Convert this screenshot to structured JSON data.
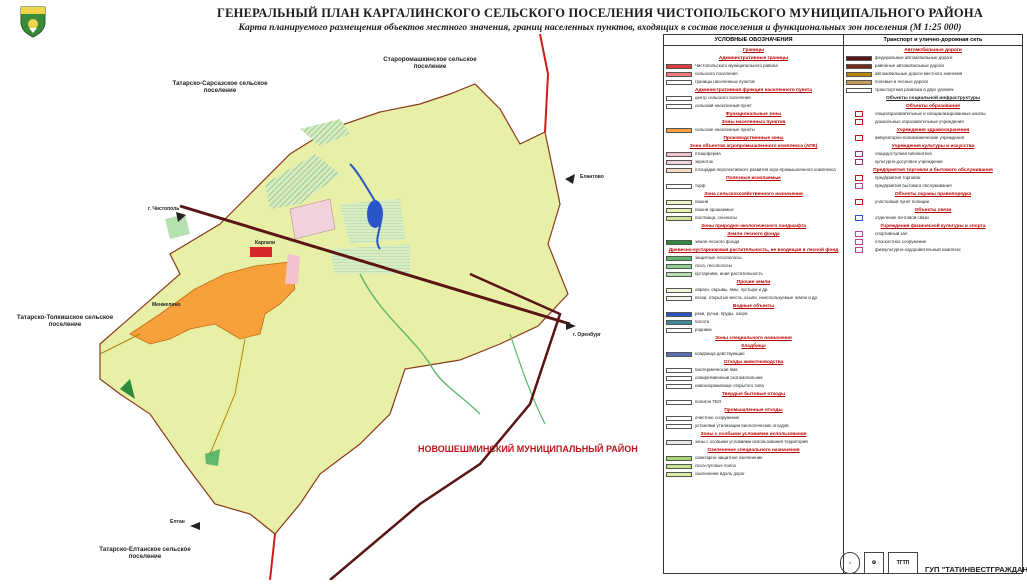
{
  "title": {
    "main": "ГЕНЕРАЛЬНЫЙ ПЛАН КАРГАЛИНСКОГО СЕЛЬСКОГО ПОСЕЛЕНИЯ ЧИСТОПОЛЬСКОГО МУНИЦИПАЛЬНОГО РАЙОНА",
    "sub": "Карта планируемого размещения объектов местного значения, границ населенных пунктов, входящих в состав поселения и функциональных зон поселения (М 1:25 000)"
  },
  "map": {
    "neighbors": [
      "Татарско-Сарсазское сельское поселение",
      "Староромашкинское сельское поселение",
      "Татарско-Толкишское сельское поселение",
      "Татарско-Елтанское сельское поселение"
    ],
    "district": "НОВОШЕШМИНСКИЙ МУНИЦИПАЛЬНЫЙ РАЙОН",
    "road_tags": [
      "г. Чистополь",
      "Елантово",
      "г. Оренбург",
      "Елтан"
    ],
    "villages": [
      "Каргали",
      "Менжелино"
    ],
    "colors": {
      "territory": "#e7f0a6",
      "settlement": "#f7a03c",
      "forest": "#c6e99b",
      "water": "#2a55c8",
      "road": "#5a1414",
      "boundary": "#d11a1a",
      "district_text": "#c0141c"
    }
  },
  "legend": {
    "left_header": "УСЛОВНЫЕ ОБОЗНАЧЕНИЯ",
    "right_header": "Транспорт и улично-дорожная сеть",
    "left": [
      {
        "kind": "sec",
        "text": "Границы"
      },
      {
        "kind": "sec",
        "text": "Административные границы"
      },
      {
        "kind": "row",
        "swatch": "#e23b3b",
        "text": "Чистопольского муниципального района"
      },
      {
        "kind": "row",
        "swatch": "#f07a7a",
        "text": "сельского поселения"
      },
      {
        "kind": "row",
        "swatch": "#ffffff",
        "text": "границы населенных пунктов"
      },
      {
        "kind": "sec",
        "text": "Административная функция населенного пункта"
      },
      {
        "kind": "row",
        "swatch": "#ffffff",
        "text": "центр сельского поселения"
      },
      {
        "kind": "row",
        "swatch": "#ffffff",
        "text": "сельский населенный пункт"
      },
      {
        "kind": "sec",
        "text": "Функциональные зоны"
      },
      {
        "kind": "sec",
        "text": "Зоны населенных пунктов"
      },
      {
        "kind": "row",
        "swatch": "#f7a03c",
        "text": "сельские населенные пункты"
      },
      {
        "kind": "sec",
        "text": "Производственные зоны"
      },
      {
        "kind": "sec",
        "text": "Зона объектов агропромышленного комплекса (АПК)"
      },
      {
        "kind": "row",
        "swatch": "#f3c2cc",
        "text": "птицеферма"
      },
      {
        "kind": "row",
        "swatch": "#f0d2da",
        "text": "зерноток"
      },
      {
        "kind": "row",
        "swatch": "#f4dcc0",
        "text": "площадки перспективного развития агро-промышленного комплекса"
      },
      {
        "kind": "sec",
        "text": "Полезные ископаемые"
      },
      {
        "kind": "row",
        "swatch": "#ffffff",
        "text": "торф"
      },
      {
        "kind": "sec",
        "text": "Зона сельскохозяйственного назначения"
      },
      {
        "kind": "row",
        "swatch": "#f1f6c6",
        "text": "пашни"
      },
      {
        "kind": "row",
        "swatch": "#e5f2b4",
        "text": "пашни орошаемые"
      },
      {
        "kind": "row",
        "swatch": "#cfe69a",
        "text": "пастбища, сенокосы"
      },
      {
        "kind": "sec",
        "text": "Зоны природно-экологического ландшафта"
      },
      {
        "kind": "sec",
        "text": "Земли лесного фонда"
      },
      {
        "kind": "row",
        "swatch": "#2e8b3c",
        "text": "земли лесного фонда"
      },
      {
        "kind": "sec",
        "text": "Древесно-кустарниковая растительность, не входящая в лесной фонд"
      },
      {
        "kind": "row",
        "swatch": "#5fb86b",
        "text": "защитные лесополосы"
      },
      {
        "kind": "row",
        "swatch": "#8fcf8f",
        "text": "леса, лесополосы"
      },
      {
        "kind": "row",
        "swatch": "#b6e0b0",
        "text": "кустарники, иная растительность"
      },
      {
        "kind": "sec",
        "text": "Прочие земли"
      },
      {
        "kind": "row",
        "swatch": "#f4f4dc",
        "text": "овраги, обрывы, ямы, пустыри и др."
      },
      {
        "kind": "row",
        "swatch": "#f6f6e8",
        "text": "пески, открытые места, осыпи, неиспользуемые земли и др."
      },
      {
        "kind": "sec",
        "text": "Водные объекты"
      },
      {
        "kind": "row",
        "swatch": "#2a55c8",
        "text": "реки, ручьи, пруды, озера"
      },
      {
        "kind": "row",
        "swatch": "#3c8a9a",
        "text": "болота"
      },
      {
        "kind": "row",
        "swatch": "#ffffff",
        "text": "родники"
      },
      {
        "kind": "sec",
        "text": "Зоны специального назначения"
      },
      {
        "kind": "sec",
        "text": "Кладбища"
      },
      {
        "kind": "row",
        "swatch": "#5a6fb2",
        "text": "кладбища действующие"
      },
      {
        "kind": "sec",
        "text": "Отходы животноводства"
      },
      {
        "kind": "row",
        "swatch": "#ffffff",
        "text": "биотермическая яма"
      },
      {
        "kind": "row",
        "swatch": "#ffffff",
        "text": "сибиреязвенный скотомогильник"
      },
      {
        "kind": "row",
        "swatch": "#ffffff",
        "text": "навозохранилище открытого типа"
      },
      {
        "kind": "sec",
        "text": "Твердые бытовые отходы"
      },
      {
        "kind": "row",
        "swatch": "#ffffff",
        "text": "полигон ТБО"
      },
      {
        "kind": "sec",
        "text": "Промышленные отходы"
      },
      {
        "kind": "row",
        "swatch": "#ffffff",
        "text": "очистное сооружение"
      },
      {
        "kind": "row",
        "swatch": "#ffffff",
        "text": "установки утилизации биологических отходов"
      },
      {
        "kind": "sec",
        "text": "Зоны с особыми условиями использования"
      },
      {
        "kind": "row",
        "swatch": "#e8e8e8",
        "text": "зоны с особыми условиями использования территорий"
      },
      {
        "kind": "sec",
        "text": "Озеленение специального назначения"
      },
      {
        "kind": "row",
        "swatch": "#a8d870",
        "text": "санитарно-защитное озеленение"
      },
      {
        "kind": "row",
        "swatch": "#c5e58f",
        "text": "леса-лугопые пояса"
      },
      {
        "kind": "row",
        "swatch": "#d9ee9e",
        "text": "озеленение вдоль дорог"
      }
    ],
    "right": [
      {
        "kind": "sec",
        "text": "Автомобильные дороги"
      },
      {
        "kind": "row",
        "swatch": "#5a1414",
        "text": "федеральные автомобильные дороги"
      },
      {
        "kind": "row",
        "swatch": "#7a2a1a",
        "text": "районные автомобильные дороги"
      },
      {
        "kind": "row",
        "swatch": "#b8860b",
        "text": "автомобильные дороги местного значения"
      },
      {
        "kind": "row",
        "swatch": "#c89a5a",
        "text": "полевые и лесные дороги"
      },
      {
        "kind": "row",
        "swatch": "#ffffff",
        "text": "транспортная развязка в двух уровнях"
      },
      {
        "kind": "sec",
        "text": "Объекты социальной инфраструктуры",
        "black": true
      },
      {
        "kind": "sec",
        "text": "Объекты образования"
      },
      {
        "kind": "icon",
        "color": "#c0141c",
        "text": "общеобразовательные и специализированные школы"
      },
      {
        "kind": "icon",
        "color": "#c0141c",
        "text": "дошкольные образовательные учреждения"
      },
      {
        "kind": "sec",
        "text": "Учреждения здравоохранения"
      },
      {
        "kind": "icon",
        "color": "#c0141c",
        "text": "амбулаторно-поликлинические учреждения"
      },
      {
        "kind": "sec",
        "text": "Учреждения культуры и искусства"
      },
      {
        "kind": "icon",
        "color": "#9a2a7a",
        "text": "общедоступная библиотека"
      },
      {
        "kind": "icon",
        "color": "#9a2a7a",
        "text": "культурно-досуговое учреждение"
      },
      {
        "kind": "sec",
        "text": "Предприятия торговли и бытового обслуживания"
      },
      {
        "kind": "icon",
        "color": "#c0141c",
        "text": "предприятия торговли"
      },
      {
        "kind": "icon",
        "color": "#c040a0",
        "text": "предприятия бытового обслуживания"
      },
      {
        "kind": "sec",
        "text": "Объекты охраны правопорядка"
      },
      {
        "kind": "icon",
        "color": "#c0141c",
        "text": "участковый пункт полиции"
      },
      {
        "kind": "sec",
        "text": "Объекты связи"
      },
      {
        "kind": "icon",
        "color": "#2a55c8",
        "text": "отделение почтовой связи"
      },
      {
        "kind": "sec",
        "text": "Учреждения физической культуры и спорта"
      },
      {
        "kind": "icon",
        "color": "#c040a0",
        "text": "спортивный зал"
      },
      {
        "kind": "icon",
        "color": "#c040a0",
        "text": "плоскостное сооружение"
      },
      {
        "kind": "icon",
        "color": "#c040a0",
        "text": "физкультурно-оздоровительный комплекс"
      }
    ]
  },
  "footer": {
    "org": "ГУП \"ТАТИНВЕСТГРАЖДАНПРОЕКТ\""
  }
}
